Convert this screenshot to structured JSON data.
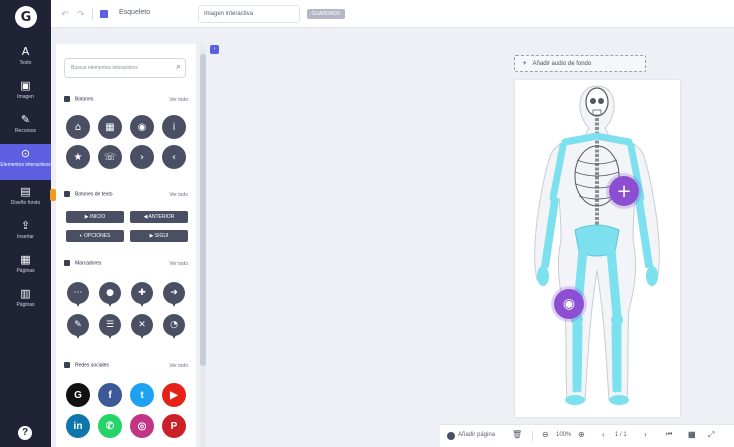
{
  "topbar": {
    "title": "Esqueleto",
    "type_select": "Imagen interactiva",
    "badge": "GUARDADO"
  },
  "rail": {
    "logo": "G",
    "items": [
      {
        "icon": "text-icon",
        "glyph": "A",
        "label": "Texto"
      },
      {
        "icon": "image-icon",
        "glyph": "▣",
        "label": "Imagen"
      },
      {
        "icon": "resources-icon",
        "glyph": "✎",
        "label": "Recursos"
      },
      {
        "icon": "interactive-elements-icon",
        "glyph": "⊙",
        "label": "Elementos interactivos"
      },
      {
        "icon": "backgrounds-icon",
        "glyph": "▤",
        "label": "Diseño fondo"
      },
      {
        "icon": "upload-icon",
        "glyph": "⇪",
        "label": "Insertar"
      },
      {
        "icon": "pages-icon",
        "glyph": "▦",
        "label": "Páginas"
      },
      {
        "icon": "pages-list-icon",
        "glyph": "▥",
        "label": "Páginas"
      }
    ],
    "help": "?"
  },
  "panel": {
    "search_placeholder": "Buscar elementos interactivos",
    "sections": {
      "buttons": {
        "title": "Botones",
        "see_all": "Ver todo"
      },
      "text_buttons": {
        "title": "Botones de texto",
        "see_all": "Ver todo"
      },
      "markers": {
        "title": "Marcadores",
        "see_all": "Ver todo"
      },
      "social": {
        "title": "Redes sociales",
        "see_all": "Ver todo"
      }
    },
    "circle_buttons": [
      {
        "icon": "home-icon",
        "glyph": "⌂"
      },
      {
        "icon": "grid-icon",
        "glyph": "▦"
      },
      {
        "icon": "eye-icon",
        "glyph": "◉"
      },
      {
        "icon": "info-icon",
        "glyph": "i"
      },
      {
        "icon": "star-icon",
        "glyph": "★"
      },
      {
        "icon": "phone-icon",
        "glyph": "☏"
      },
      {
        "icon": "next-icon",
        "glyph": "›"
      },
      {
        "icon": "prev-icon",
        "glyph": "‹"
      }
    ],
    "text_buttons": [
      "▶ INICIO",
      "◀ ANTERIOR",
      "◐ OPCIONES",
      "▶ SIGUI"
    ],
    "pins": [
      {
        "icon": "pin-dots-icon",
        "glyph": "⋯"
      },
      {
        "icon": "pin-marker-icon",
        "glyph": "●"
      },
      {
        "icon": "pin-cross-icon",
        "glyph": "✚"
      },
      {
        "icon": "pin-arrow-icon",
        "glyph": "➜"
      },
      {
        "icon": "pin-edit-icon",
        "glyph": "✎"
      },
      {
        "icon": "pin-chat-icon",
        "glyph": "☰"
      },
      {
        "icon": "pin-close-icon",
        "glyph": "✕"
      },
      {
        "icon": "pin-bubble-icon",
        "glyph": "◔"
      }
    ],
    "socials": [
      {
        "icon": "genially-icon",
        "glyph": "G",
        "color": "#111111"
      },
      {
        "icon": "facebook-icon",
        "glyph": "f",
        "color": "#3b5998"
      },
      {
        "icon": "twitter-icon",
        "glyph": "t",
        "color": "#1da1f2"
      },
      {
        "icon": "youtube-icon",
        "glyph": "▶",
        "color": "#e62117"
      },
      {
        "icon": "linkedin-icon",
        "glyph": "in",
        "color": "#0e76a8"
      },
      {
        "icon": "whatsapp-icon",
        "glyph": "✆",
        "color": "#25d366"
      },
      {
        "icon": "instagram-icon",
        "glyph": "◎",
        "color": "#c13584"
      },
      {
        "icon": "pinterest-icon",
        "glyph": "P",
        "color": "#cb2027"
      }
    ]
  },
  "canvas": {
    "bg_audio": "Añadir audio de fondo",
    "bg_audio_plus": "+",
    "hotspot_plus": "+",
    "hotspot_eye": "◉",
    "accent": "#8c4fd1",
    "bone_color": "#7de0ee"
  },
  "bottombar": {
    "add_page": "Añadir página",
    "zoom": "100%",
    "page_counter": "1 / 1"
  }
}
